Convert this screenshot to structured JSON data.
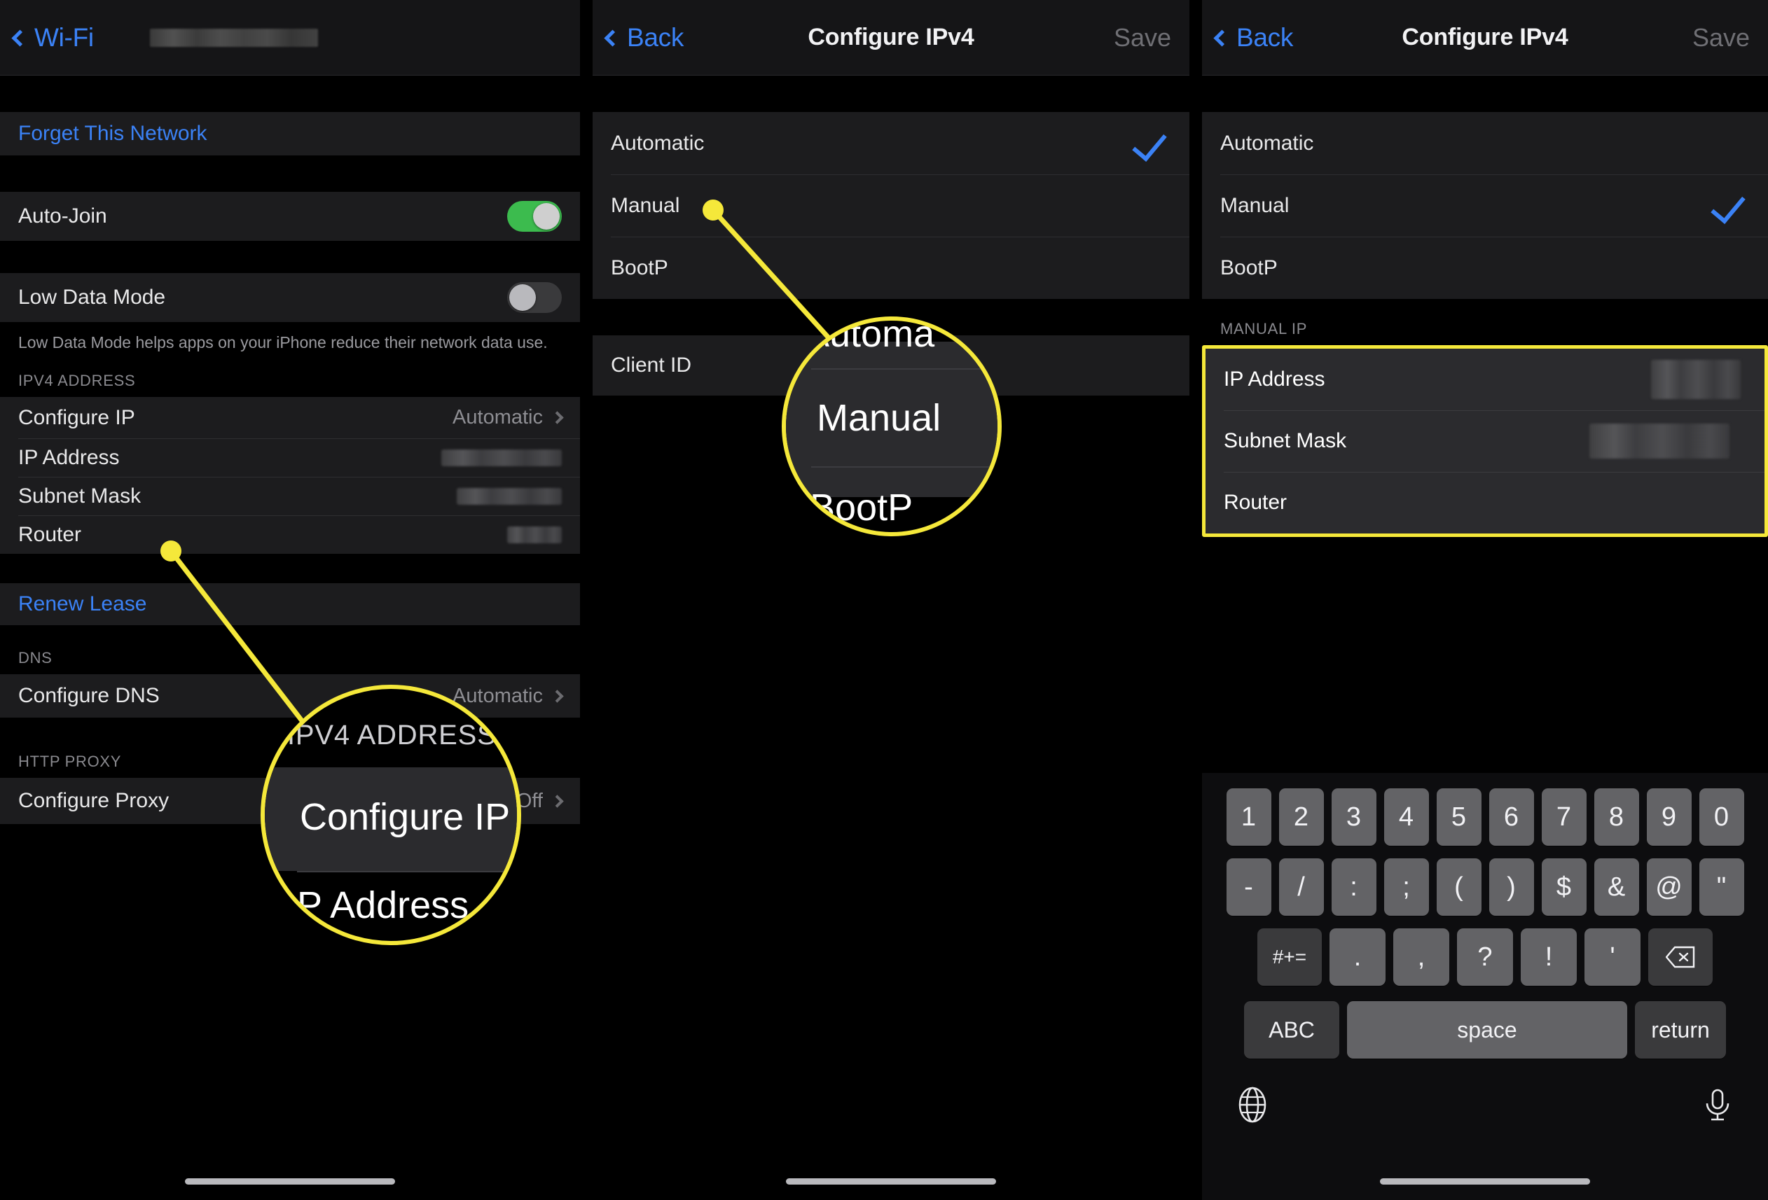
{
  "panel1": {
    "nav": {
      "back_label": "Wi-Fi",
      "network_name_redacted": true
    },
    "forget_network": "Forget This Network",
    "auto_join": {
      "label": "Auto-Join",
      "state": "on"
    },
    "low_data_mode": {
      "label": "Low Data Mode",
      "state": "off"
    },
    "low_data_footnote": "Low Data Mode helps apps on your iPhone reduce their network data use.",
    "ipv4_section_header": "IPV4 ADDRESS",
    "configure_ip": {
      "label": "Configure IP",
      "value": "Automatic"
    },
    "ip_address": {
      "label": "IP Address",
      "value_redacted": true
    },
    "subnet_mask": {
      "label": "Subnet Mask",
      "value_redacted": true
    },
    "router": {
      "label": "Router",
      "value_redacted": true
    },
    "renew_lease": "Renew Lease",
    "dns_section_header": "DNS",
    "configure_dns": {
      "label": "Configure DNS",
      "value": "Automatic"
    },
    "proxy_section_header": "HTTP PROXY",
    "configure_proxy": {
      "label": "Configure Proxy",
      "value": "Off"
    },
    "magnifier": {
      "header": "IPV4 ADDRESS",
      "row_main": "Configure IP",
      "row_below": "P Address"
    }
  },
  "panel2": {
    "nav": {
      "back_label": "Back",
      "title": "Configure IPv4",
      "save_label": "Save"
    },
    "options": [
      {
        "label": "Automatic",
        "checked": true
      },
      {
        "label": "Manual",
        "checked": false
      },
      {
        "label": "BootP",
        "checked": false
      }
    ],
    "client_id": {
      "label": "Client ID"
    },
    "magnifier": {
      "row_above": "Automa",
      "row_main": "Manual",
      "row_below": "BootP"
    }
  },
  "panel3": {
    "nav": {
      "back_label": "Back",
      "title": "Configure IPv4",
      "save_label": "Save"
    },
    "options": [
      {
        "label": "Automatic",
        "checked": false
      },
      {
        "label": "Manual",
        "checked": true
      },
      {
        "label": "BootP",
        "checked": false
      }
    ],
    "manual_ip_header": "MANUAL IP",
    "manual_fields": [
      {
        "label": "IP Address",
        "value_redacted": true,
        "focused": true
      },
      {
        "label": "Subnet Mask",
        "value_redacted": true,
        "focused": false
      },
      {
        "label": "Router",
        "value_redacted": false,
        "focused": false
      }
    ],
    "keyboard": {
      "row1": [
        "1",
        "2",
        "3",
        "4",
        "5",
        "6",
        "7",
        "8",
        "9",
        "0"
      ],
      "row2": [
        "-",
        "/",
        ":",
        ";",
        "(",
        ")",
        "$",
        "&",
        "@",
        "\""
      ],
      "row3_shift": "#+=",
      "row3": [
        ".",
        ",",
        "?",
        "!",
        "'"
      ],
      "row3_delete_icon": "backspace-icon",
      "row4": {
        "abc": "ABC",
        "space": "space",
        "return": "return"
      },
      "globe_icon": "globe-icon",
      "mic_icon": "microphone-icon"
    }
  },
  "annotation": {
    "highlight_color": "#F5E83A",
    "accent_blue": "#3B82F6",
    "toggle_on_green": "#3CBB4E"
  }
}
